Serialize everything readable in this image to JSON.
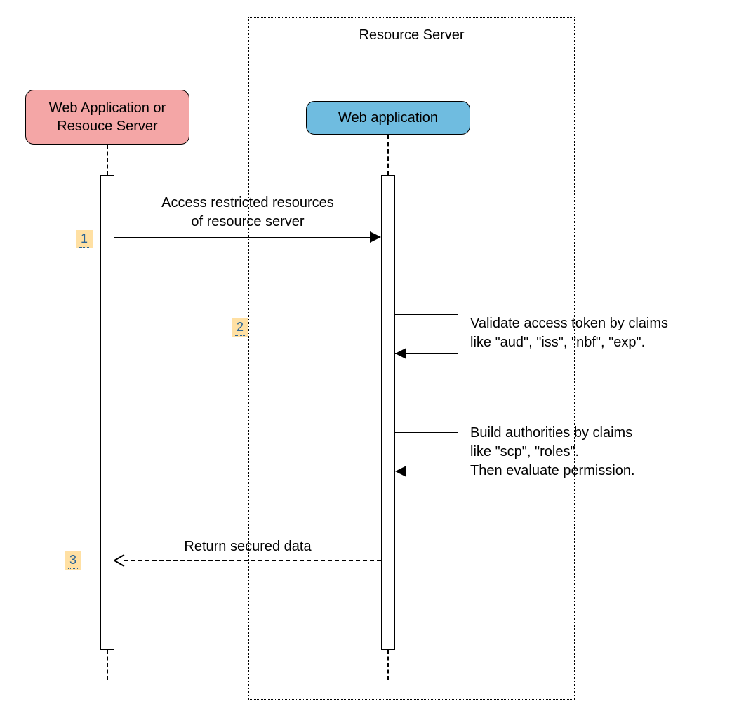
{
  "container": {
    "title": "Resource Server"
  },
  "participants": {
    "left": {
      "line1": "Web Application or",
      "line2": "Resouce Server"
    },
    "right": {
      "label": "Web application"
    }
  },
  "steps": {
    "s1": "1",
    "s2": "2",
    "s3": "3"
  },
  "messages": {
    "m1": {
      "line1": "Access restricted resources",
      "line2": "of resource server"
    },
    "m3": {
      "line1": "Return secured data"
    }
  },
  "notes": {
    "n2": {
      "line1": "Validate access token by claims",
      "line2": "like \"aud\", \"iss\", \"nbf\", \"exp\"."
    },
    "n3": {
      "line1": "Build authorities by claims",
      "line2": "like \"scp\", \"roles\".",
      "line3": "Then evaluate permission."
    }
  }
}
